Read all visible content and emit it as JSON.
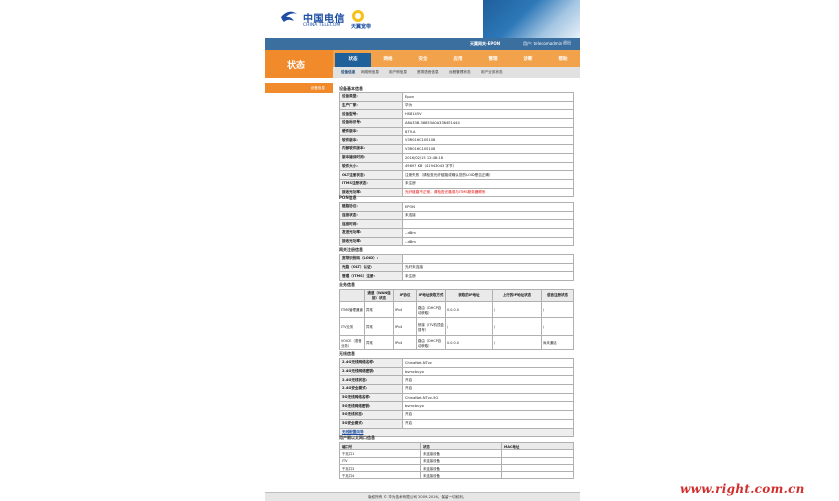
{
  "brand": {
    "name_cn": "中国电信",
    "name_en": "CHINA TELECOM",
    "sub": "天翼宽带"
  },
  "topbar": {
    "version": "天翼网关-EPON",
    "user": "用户: telecomadmin",
    "logout": "退出"
  },
  "page_title": "状态",
  "nav": [
    "状态",
    "网络",
    "安全",
    "应用",
    "管理",
    "诊断",
    "帮助"
  ],
  "subnav": [
    "设备信息",
    "网络侧信息",
    "用户侧信息",
    "宽带语音信息",
    "远程管理状态",
    "用户业务状态"
  ],
  "sidebar": {
    "item": "设备信息"
  },
  "device": {
    "title": "设备基本信息",
    "rows": [
      {
        "k": "设备类型:",
        "v": "Epon"
      },
      {
        "k": "生产厂家:",
        "v": "华为"
      },
      {
        "k": "设备型号:",
        "v": "HS8145V"
      },
      {
        "k": "设备标识号:",
        "v": "A8A33B-38853A0A3364E1444"
      },
      {
        "k": "硬件版本:",
        "v": "879.A"
      },
      {
        "k": "软件版本:",
        "v": "V3R016C10S108"
      },
      {
        "k": "内部软件版本:",
        "v": "V3R016C10S108"
      },
      {
        "k": "版本编译时间:",
        "v": "2016/02/15 12:48:18"
      },
      {
        "k": "软件大小:",
        "v": "49697 KB（41943043 字节）"
      },
      {
        "k": "OLT注册状态:",
        "v": "注册失败（请检查光纤链路或确认您的LOID是否正确）"
      },
      {
        "k": "ITMS注册状态:",
        "v": "未注册"
      },
      {
        "k": "接收光功率:",
        "v": "光纤链路不正常，请检查光路或与ITMS服务器联系"
      }
    ]
  },
  "pon": {
    "title": "PON信息",
    "rows": [
      {
        "k": "链路协议:",
        "v": "EPON"
      },
      {
        "k": "连接状态:",
        "v": "未连接"
      },
      {
        "k": "连接时间:",
        "v": ""
      },
      {
        "k": "发送光功率:",
        "v": "--dBm"
      },
      {
        "k": "接收光功率:",
        "v": "--dBm"
      }
    ]
  },
  "auth": {
    "title": "网关注册信息",
    "rows": [
      {
        "k": "宽带识别码（LOID）:",
        "v": ""
      },
      {
        "k": "光路（OLT）认证:",
        "v": "光纤未连接"
      },
      {
        "k": "管理（ITMS）注册:",
        "v": "未注册"
      }
    ]
  },
  "service": {
    "title": "业务信息",
    "headers": [
      "",
      "通道（WAN连接）状态",
      "IP协议",
      "IP地址获取方式",
      "获取的IP地址",
      "上行的IP地址状态",
      "语音注册状态"
    ],
    "rows": [
      [
        "ITMS管理通道",
        "异常",
        "IPv4",
        "路由（DHCP自动获取）",
        "0.0.0.0",
        "/",
        "/"
      ],
      [
        "ITV业务",
        "异常",
        "IPv4",
        "桥接（ITV机顶盒拨号）",
        "/",
        "/",
        "/"
      ],
      [
        "VOICE（语音业务）",
        "异常",
        "IPv4",
        "路由（DHCP自动获取）",
        "0.0.0.0",
        "/",
        "尚未通话"
      ]
    ]
  },
  "wifi": {
    "title": "无线信息",
    "rows": [
      {
        "k": "2.4G无线网络名称:",
        "v": "ChinaNet-NTvz"
      },
      {
        "k": "2.4G无线网络密钥:",
        "v": "bvmcbuyo"
      },
      {
        "k": "2.4G无线状态:",
        "v": "开启"
      },
      {
        "k": "2.4G安全模式:",
        "v": "开启"
      },
      {
        "k": "5G无线网络名称:",
        "v": "ChinaNet-NTvz-5G"
      },
      {
        "k": "5G无线网络密钥:",
        "v": "bvmcbuyo"
      },
      {
        "k": "5G无线状态:",
        "v": "开启"
      },
      {
        "k": "5G安全模式:",
        "v": "开启"
      }
    ],
    "link": "无线配置向导"
  },
  "lan": {
    "title": "用户侧以太网口信息",
    "headers": [
      "端口号",
      "状态",
      "MAC地址"
    ],
    "rows": [
      [
        "千兆口1",
        "未连接设备",
        ""
      ],
      [
        "ITV",
        "未连接设备",
        ""
      ],
      [
        "千兆口3",
        "未连接设备",
        ""
      ],
      [
        "千兆口4",
        "未连接设备",
        ""
      ]
    ]
  },
  "footer": {
    "text": "版权所有 © 华为技术有限公司 2009-2016。保留一切权利。"
  },
  "watermark": "www.right.com.cn"
}
